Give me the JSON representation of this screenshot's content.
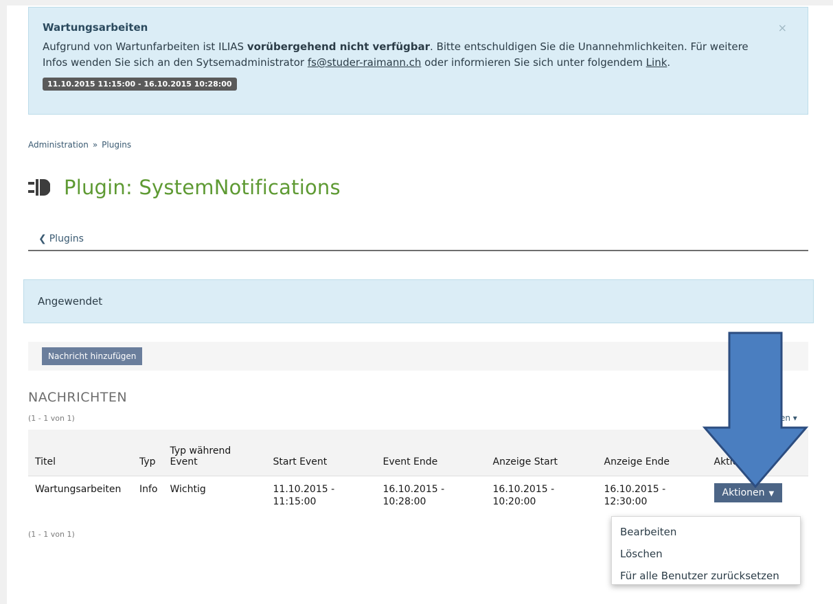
{
  "notice": {
    "title": "Wartungsarbeiten",
    "text_1": "Aufgrund von Wartunfarbeiten ist ILIAS ",
    "text_bold": "vorübergehend nicht verfügbar",
    "text_2": ". Bitte entschuldigen Sie die Unannehmlichkeiten. Für weitere Infos wenden Sie sich an den Sytsemadministrator ",
    "email": "fs@studer-raimann.ch",
    "text_3": " oder informieren Sie sich unter folgendem ",
    "link_label": "Link",
    "text_4": ".",
    "date_range": "11.10.2015 11:15:00 - 16.10.2015 10:28:00",
    "close_label": "×"
  },
  "breadcrumb": {
    "item_1": "Administration",
    "separator": "»",
    "item_2": "Plugins"
  },
  "page_title": "Plugin: SystemNotifications",
  "back_link": {
    "chevron": "❮",
    "label": "Plugins"
  },
  "applied_label": "Angewendet",
  "toolbar": {
    "add_label": "Nachricht hinzufügen"
  },
  "table": {
    "title": "NACHRICHTEN",
    "count": "(1 - 1 von 1)",
    "columns_toggle": "en ▾",
    "headers": [
      "Titel",
      "Typ",
      "Typ während Event",
      "Start Event",
      "Event Ende",
      "Anzeige Start",
      "Anzeige Ende",
      "Aktionen"
    ],
    "rows": [
      {
        "title": "Wartungsarbeiten",
        "type": "Info",
        "event_type": "Wichtig",
        "start_event": "11.10.2015 - 11:15:00",
        "event_end": "16.10.2015 - 10:28:00",
        "display_start": "16.10.2015 - 10:20:00",
        "display_end": "16.10.2015 - 12:30:00",
        "actions_label": "Aktionen"
      }
    ]
  },
  "dropdown": {
    "items": [
      "Bearbeiten",
      "Löschen",
      "Für alle Benutzer zurücksetzen"
    ]
  },
  "colors": {
    "accent_green": "#5e9a33",
    "info_bg": "#dbedf6",
    "button_blue": "#4c6586",
    "arrow_blue": "#4a7ec0"
  }
}
